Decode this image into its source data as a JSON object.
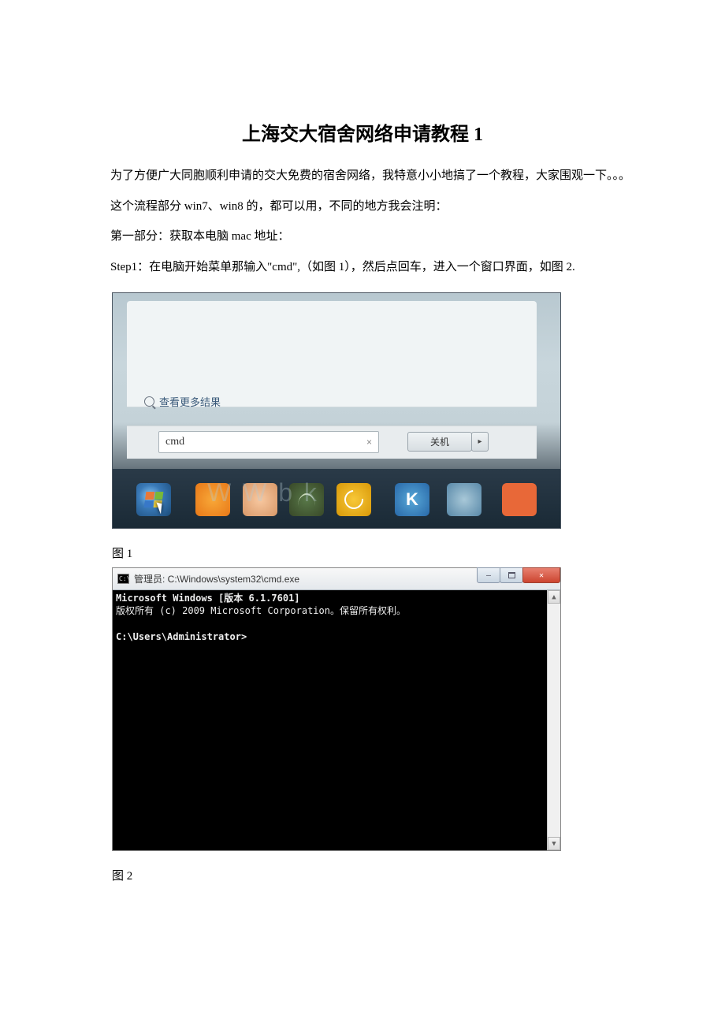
{
  "title": "上海交大宿舍网络申请教程 1",
  "paragraphs": {
    "p1": "为了方便广大同胞顺利申请的交大免费的宿舍网络，我特意小小地搞了一个教程，大家围观一下。。。",
    "p2": "这个流程部分 win7、win8 的，都可以用，不同的地方我会注明：",
    "p3": "第一部分：获取本电脑 mac 地址：",
    "p4": "Step1：在电脑开始菜单那输入\"cmd\",（如图 1），然后点回车，进入一个窗口界面，如图 2."
  },
  "captions": {
    "fig1": "图 1",
    "fig2": "图 2"
  },
  "figure1": {
    "more_results": "查看更多结果",
    "search_text": "cmd",
    "clear_x": "×",
    "shutdown": "关机",
    "arrow": "▸",
    "k_letter": "K",
    "logo_overlay": "W W   b       k"
  },
  "figure2": {
    "title": "管理员: C:\\Windows\\system32\\cmd.exe",
    "icon_text": "C:\\",
    "minimize": "—",
    "close": "✕",
    "line1": "Microsoft Windows [版本 6.1.7601]",
    "line2": "版权所有 (c) 2009 Microsoft Corporation。保留所有权利。",
    "prompt": "C:\\Users\\Administrator>",
    "arrow_up": "▲",
    "arrow_down": "▼"
  }
}
